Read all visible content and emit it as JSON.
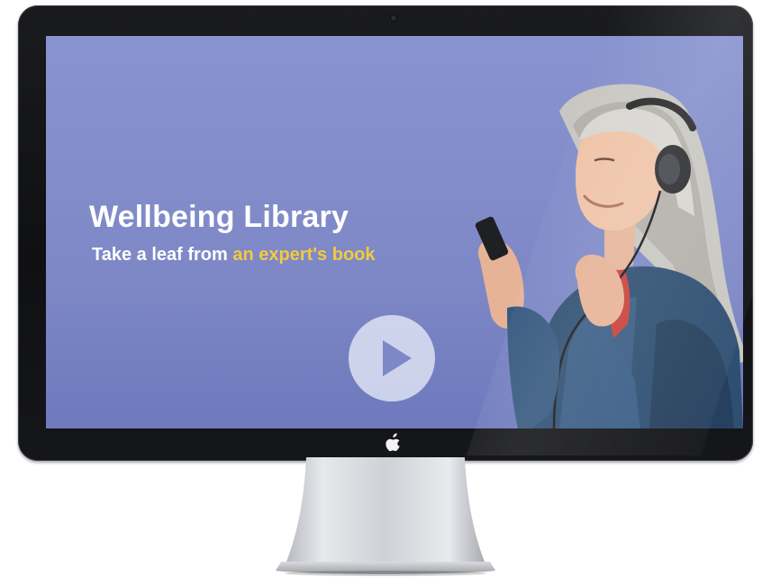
{
  "screen": {
    "title": "Wellbeing Library",
    "subtitle_prefix": "Take a leaf from ",
    "subtitle_highlight": "an expert's book"
  },
  "icons": {
    "play": "play-icon",
    "apple_logo": "apple-logo-icon",
    "camera": "camera-icon"
  },
  "colors": {
    "screen_background": "#8490CC",
    "title_text": "#FFFFFF",
    "highlight_text": "#F3C940",
    "play_button": "#E2E5F5",
    "bezel": "#141518",
    "stand": "#C9CBD0"
  }
}
